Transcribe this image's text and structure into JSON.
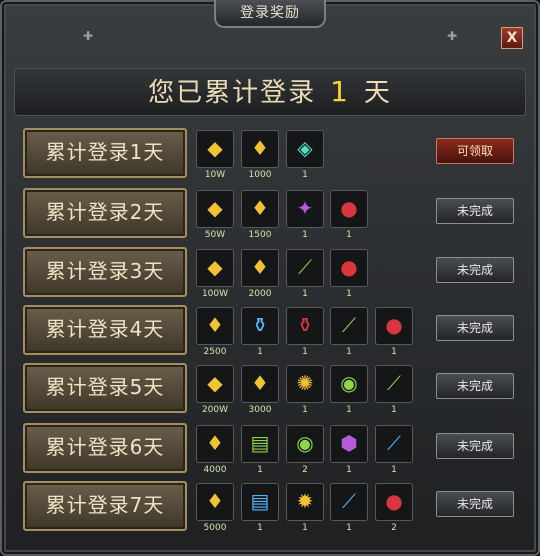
{
  "window": {
    "title": "登录奖励",
    "close_label": "X"
  },
  "header": {
    "prefix": "您已累计登录",
    "days": "1",
    "suffix": "天"
  },
  "rows": [
    {
      "label": "累计登录1天",
      "status": "可领取",
      "claimable": true,
      "items": [
        {
          "icon": "gold-ingot-icon",
          "count": "10W"
        },
        {
          "icon": "gold-bag-icon",
          "count": "1000"
        },
        {
          "icon": "jade-box-icon",
          "count": "1"
        }
      ]
    },
    {
      "label": "累计登录2天",
      "status": "未完成",
      "claimable": false,
      "items": [
        {
          "icon": "gold-ingot-icon",
          "count": "50W"
        },
        {
          "icon": "gold-bag-icon",
          "count": "1500"
        },
        {
          "icon": "wings-icon",
          "count": "1"
        },
        {
          "icon": "red-gem-icon",
          "count": "1"
        }
      ]
    },
    {
      "label": "累计登录3天",
      "status": "未完成",
      "claimable": false,
      "items": [
        {
          "icon": "gold-ingot-icon",
          "count": "100W"
        },
        {
          "icon": "gold-bag-icon",
          "count": "2000"
        },
        {
          "icon": "green-feather-icon",
          "count": "1"
        },
        {
          "icon": "red-gem-icon",
          "count": "1"
        }
      ]
    },
    {
      "label": "累计登录4天",
      "status": "未完成",
      "claimable": false,
      "items": [
        {
          "icon": "gold-bag-icon",
          "count": "2500"
        },
        {
          "icon": "blue-potion-icon",
          "count": "1"
        },
        {
          "icon": "red-potion-icon",
          "count": "1"
        },
        {
          "icon": "green-feather-icon",
          "count": "1"
        },
        {
          "icon": "red-gem-icon",
          "count": "1"
        }
      ]
    },
    {
      "label": "累计登录5天",
      "status": "未完成",
      "claimable": false,
      "items": [
        {
          "icon": "gold-ingot-icon",
          "count": "200W"
        },
        {
          "icon": "gold-bag-icon",
          "count": "3000"
        },
        {
          "icon": "fire-emblem-icon",
          "count": "1"
        },
        {
          "icon": "green-orb-icon",
          "count": "1"
        },
        {
          "icon": "green-feather-icon",
          "count": "1"
        }
      ]
    },
    {
      "label": "累计登录6天",
      "status": "未完成",
      "claimable": false,
      "items": [
        {
          "icon": "gold-bag-icon",
          "count": "4000"
        },
        {
          "icon": "green-scroll-icon",
          "count": "1"
        },
        {
          "icon": "green-orb-icon",
          "count": "2"
        },
        {
          "icon": "purple-gem-icon",
          "count": "1"
        },
        {
          "icon": "blue-feather-icon",
          "count": "1"
        }
      ]
    },
    {
      "label": "累计登录7天",
      "status": "未完成",
      "claimable": false,
      "items": [
        {
          "icon": "gold-bag-icon",
          "count": "5000"
        },
        {
          "icon": "blue-scroll-icon",
          "count": "1"
        },
        {
          "icon": "fire-torch-icon",
          "count": "1"
        },
        {
          "icon": "blue-feather-icon",
          "count": "1"
        },
        {
          "icon": "red-gem-icon",
          "count": "2"
        }
      ]
    }
  ]
}
